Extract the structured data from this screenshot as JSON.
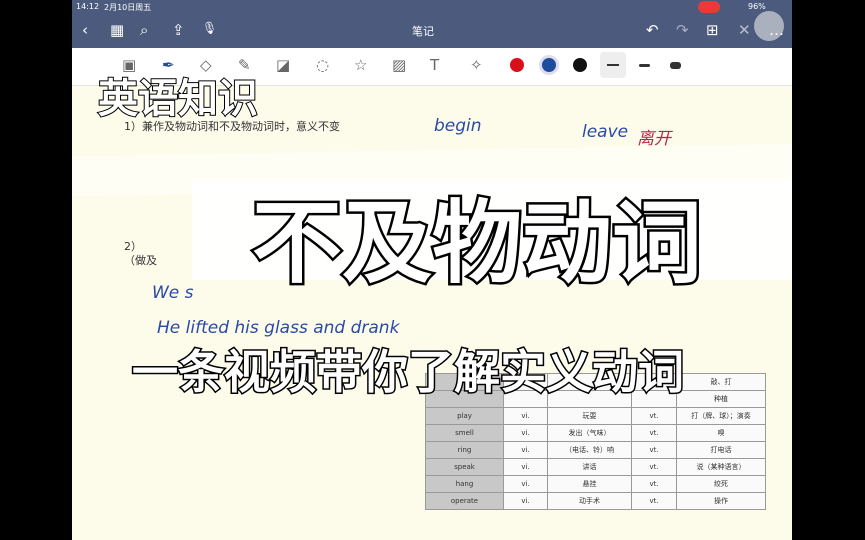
{
  "status": {
    "time": "14:12",
    "date": "2月10日周五",
    "battery": "96%"
  },
  "nav": {
    "title": "笔记",
    "back": "‹",
    "grid": "▦",
    "search": "⌕",
    "share": "⇪",
    "mic": "🎙",
    "undo": "↶",
    "redo": "↷",
    "add_page": "⊞",
    "close": "✕",
    "more": "…"
  },
  "toolbar": {
    "colors": [
      "#d8101a",
      "#1d4d9c",
      "#111111"
    ],
    "icons": [
      "image-add",
      "pen",
      "eraser",
      "highlighter",
      "shapes",
      "lasso",
      "sticker",
      "image",
      "text",
      "laser"
    ]
  },
  "note": {
    "line1": "1）兼作及物动词和不及物动词时，意义不变",
    "line2a": "2）",
    "line2b": "（做及",
    "hand": [
      "begin",
      "leave",
      "离开",
      "We s",
      "He lifted his glass and drank"
    ]
  },
  "overlay": {
    "corner": "英语知识",
    "main": "不及物动词",
    "sub": "一条视频带你了解实义动词"
  },
  "table": {
    "rows": [
      [
        "",
        "",
        "",
        "",
        "敲、打"
      ],
      [
        "",
        "",
        "",
        "",
        "种植"
      ],
      [
        "play",
        "vi.",
        "玩耍",
        "vt.",
        "打（牌、球）；演奏"
      ],
      [
        "smell",
        "vi.",
        "发出（气味）",
        "vt.",
        "嗅"
      ],
      [
        "ring",
        "vi.",
        "（电话、铃）响",
        "vt.",
        "打电话"
      ],
      [
        "speak",
        "vi.",
        "讲话",
        "vt.",
        "说（某种语言）"
      ],
      [
        "hang",
        "vi.",
        "悬挂",
        "vt.",
        "绞死"
      ],
      [
        "operate",
        "vi.",
        "动手术",
        "vt.",
        "操作"
      ]
    ]
  }
}
